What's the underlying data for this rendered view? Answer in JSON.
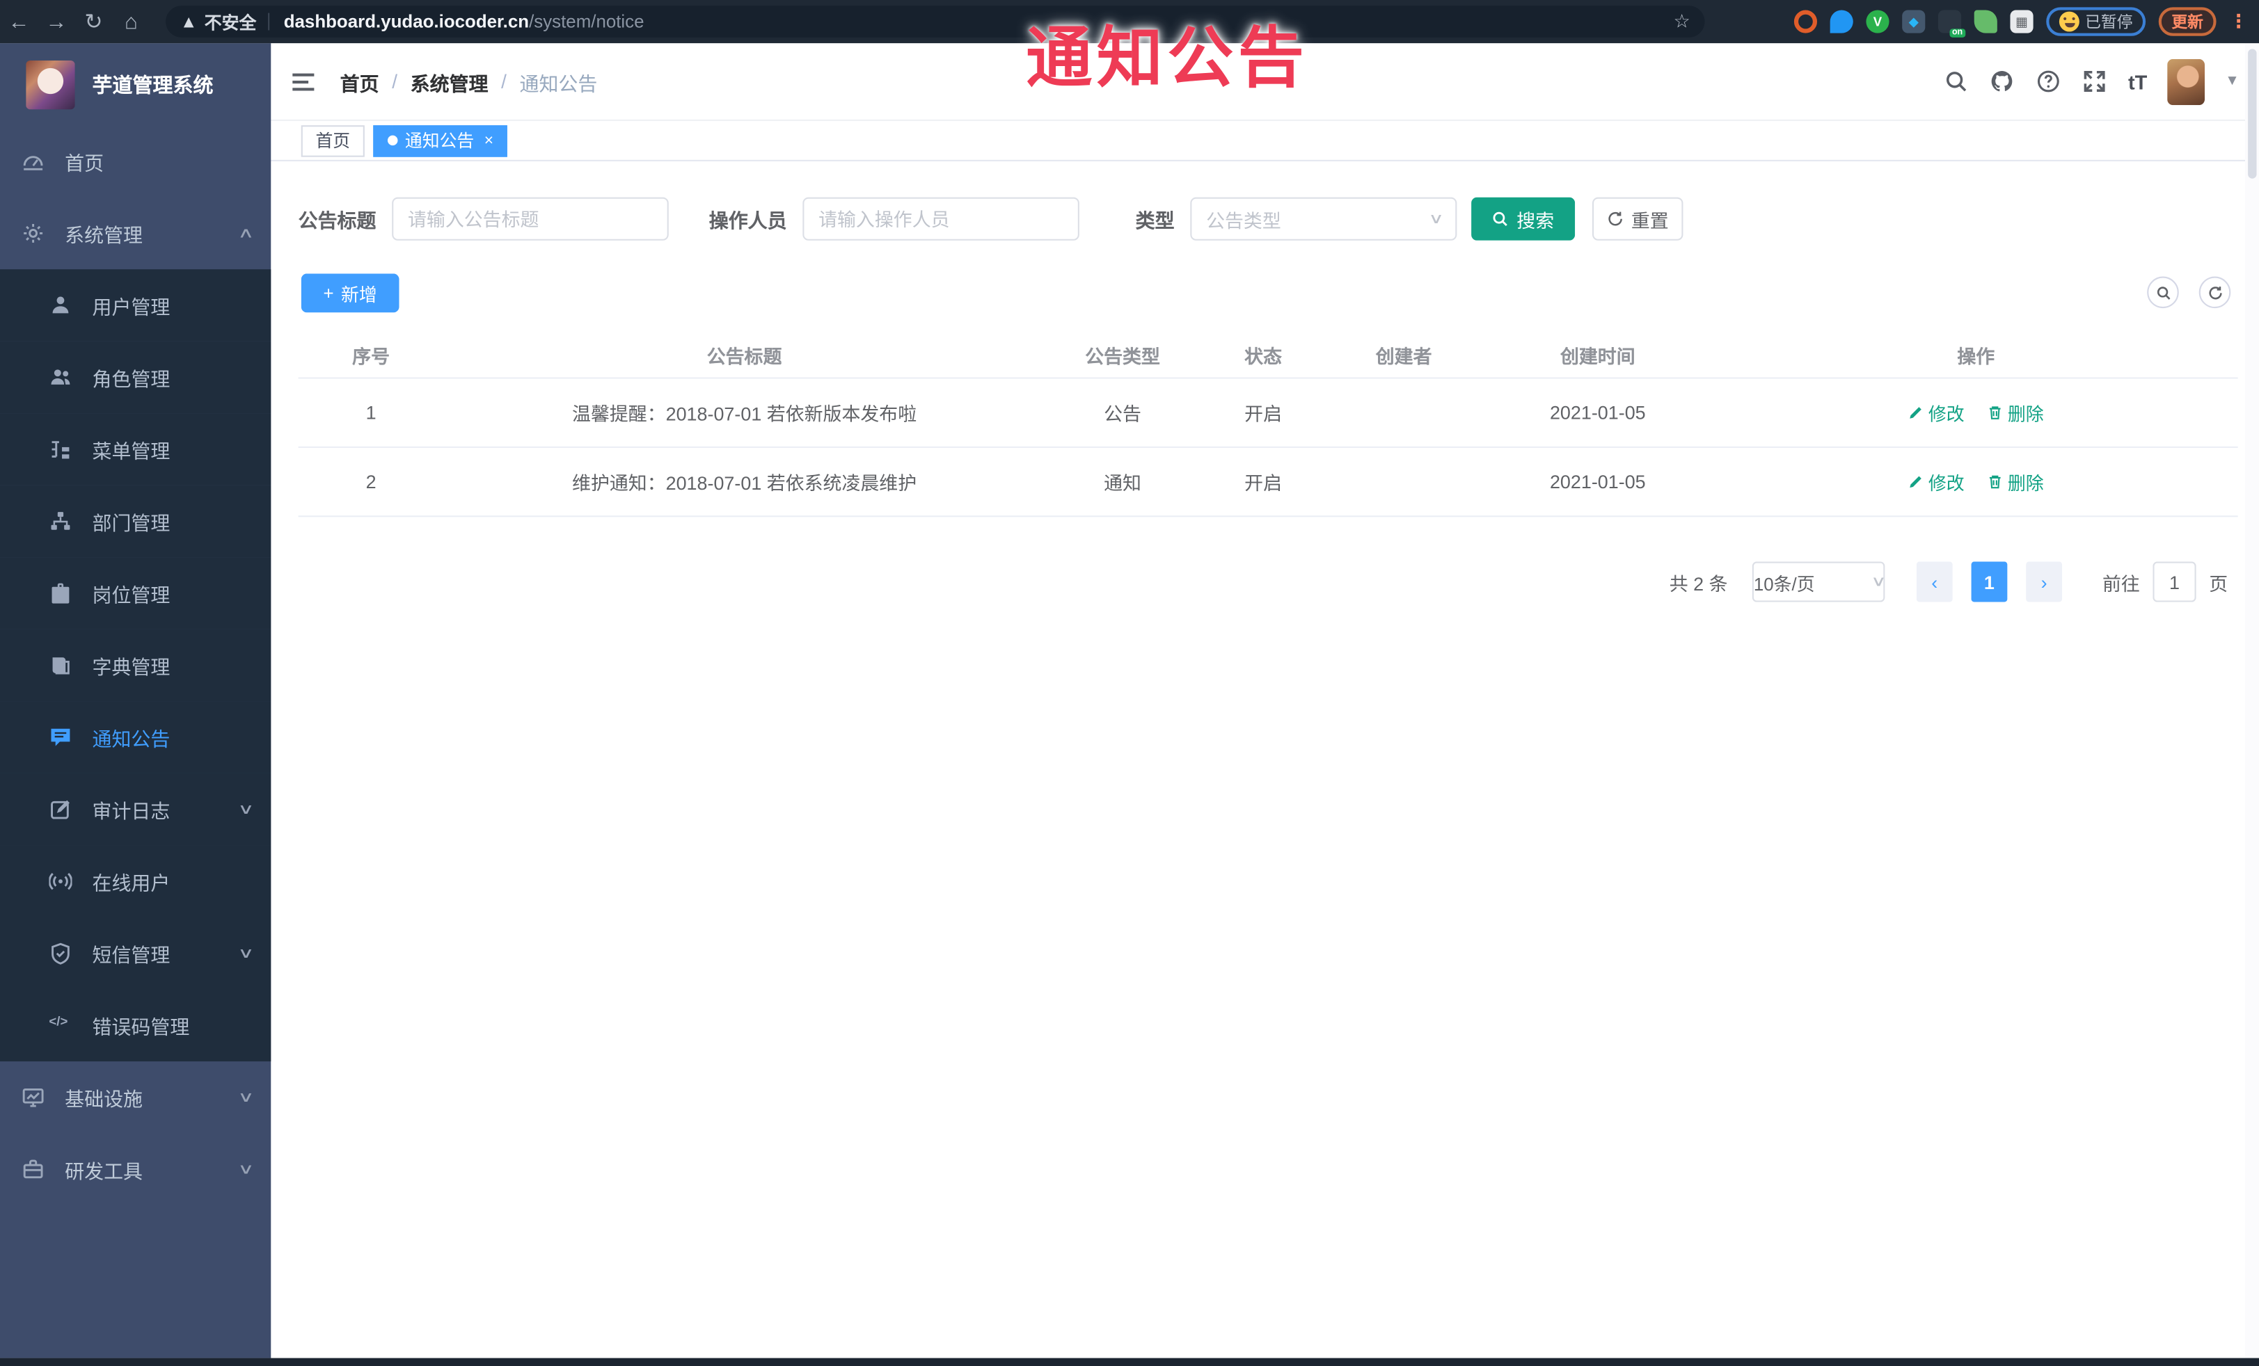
{
  "browser": {
    "security_label": "不安全",
    "url_host": "dashboard.yudao.iocoder.cn",
    "url_path": "/system/notice",
    "paused_label": "已暂停",
    "update_label": "更新",
    "on_badge": "on"
  },
  "overlay": {
    "title": "通知公告"
  },
  "sidebar": {
    "logo_title": "芋道管理系统",
    "items": [
      {
        "label": "首页",
        "icon": "dashboard-icon",
        "level": "top"
      },
      {
        "label": "系统管理",
        "icon": "gear-icon",
        "level": "top",
        "arrow": "up"
      },
      {
        "label": "用户管理",
        "icon": "user-icon",
        "level": "sub"
      },
      {
        "label": "角色管理",
        "icon": "users-icon",
        "level": "sub"
      },
      {
        "label": "菜单管理",
        "icon": "menu-tree-icon",
        "level": "sub"
      },
      {
        "label": "部门管理",
        "icon": "org-tree-icon",
        "level": "sub"
      },
      {
        "label": "岗位管理",
        "icon": "briefcase-icon",
        "level": "sub"
      },
      {
        "label": "字典管理",
        "icon": "book-icon",
        "level": "sub"
      },
      {
        "label": "通知公告",
        "icon": "chat-icon",
        "level": "sub",
        "active": true
      },
      {
        "label": "审计日志",
        "icon": "edit-log-icon",
        "level": "sub",
        "arrow": "down"
      },
      {
        "label": "在线用户",
        "icon": "online-icon",
        "level": "sub"
      },
      {
        "label": "短信管理",
        "icon": "shield-icon",
        "level": "sub",
        "arrow": "down"
      },
      {
        "label": "错误码管理",
        "icon": "code-icon",
        "level": "sub"
      },
      {
        "label": "基础设施",
        "icon": "monitor-icon",
        "level": "top",
        "arrow": "down"
      },
      {
        "label": "研发工具",
        "icon": "toolbox-icon",
        "level": "top",
        "arrow": "down"
      }
    ]
  },
  "header": {
    "breadcrumb": [
      "首页",
      "系统管理",
      "通知公告"
    ],
    "font_icon_label": "tT"
  },
  "tabs": [
    {
      "label": "首页"
    },
    {
      "label": "通知公告",
      "close": "×"
    }
  ],
  "filters": {
    "title_label": "公告标题",
    "title_placeholder": "请输入公告标题",
    "operator_label": "操作人员",
    "operator_placeholder": "请输入操作人员",
    "type_label": "类型",
    "type_placeholder": "公告类型",
    "search_label": "搜索",
    "reset_label": "重置"
  },
  "toolbar": {
    "add_label": "新增"
  },
  "table": {
    "columns": [
      "序号",
      "公告标题",
      "公告类型",
      "状态",
      "创建者",
      "创建时间",
      "操作"
    ],
    "rows": [
      {
        "no": "1",
        "title": "温馨提醒：2018-07-01 若依新版本发布啦",
        "type": "公告",
        "status": "开启",
        "creator": "",
        "created": "2021-01-05"
      },
      {
        "no": "2",
        "title": "维护通知：2018-07-01 若依系统凌晨维护",
        "type": "通知",
        "status": "开启",
        "creator": "",
        "created": "2021-01-05"
      }
    ],
    "edit_label": "修改",
    "delete_label": "删除"
  },
  "pagination": {
    "total": "共 2 条",
    "page_size": "10条/页",
    "current_page": "1",
    "goto_label": "前往",
    "goto_value": "1",
    "page_unit": "页"
  },
  "colors": {
    "accent_blue": "#409eff",
    "teal_action": "#13a285",
    "overlay_red": "#ee3b55",
    "sidebar_bg": "#3e4c6b",
    "submenu_bg": "#1f2d3d"
  }
}
